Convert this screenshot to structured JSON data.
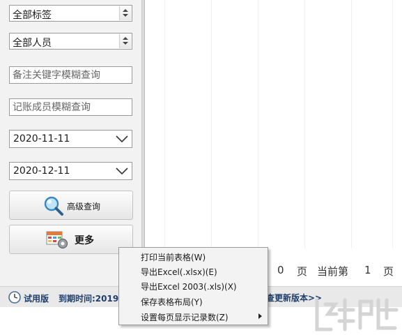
{
  "filters": {
    "tag_select": "全部标签",
    "person_select": "全部人员",
    "remark_search_placeholder": "备注关键字模糊查询",
    "member_search_placeholder": "记账成员模糊查询",
    "start_date": "2020-11-11",
    "end_date": "2020-12-11"
  },
  "buttons": {
    "advanced_query": "高级查询",
    "more": "更多"
  },
  "pager": {
    "total_pages": "0",
    "page_unit": "页",
    "current_label": "当前第",
    "current_page": "1",
    "page_unit2": "页"
  },
  "status_bar": {
    "trial_label": "试用版",
    "expire_label": "到期时间:2019-",
    "update_link": "查更新版本>>"
  },
  "context_menu": {
    "items": [
      {
        "label": "打印当前表格(W)"
      },
      {
        "label": "导出Excel(.xlsx)(E)"
      },
      {
        "label": "导出Excel 2003(.xls)(X)"
      },
      {
        "label": "保存表格布局(Y)"
      },
      {
        "label": "设置每页显示记录数(Z)"
      }
    ]
  },
  "colors": {
    "panel_bg": "#f2f2f2",
    "status_text": "#1f3e6c",
    "menu_bg": "#f3f3f3"
  },
  "icons": [
    "magnifier-icon",
    "table-gear-icon",
    "clock-icon",
    "chevron-down-icon",
    "submenu-arrow-icon"
  ]
}
